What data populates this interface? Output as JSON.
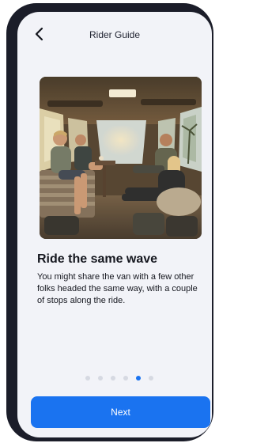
{
  "header": {
    "title": "Rider Guide",
    "back_icon": "chevron-left-icon"
  },
  "content": {
    "image_alt": "Surfers sharing a ride inside a van",
    "headline": "Ride the same wave",
    "description": " You might share the van with a few other folks headed the same way, with a couple of stops along the ride."
  },
  "pagination": {
    "total": 6,
    "current": 5
  },
  "footer": {
    "next_label": "Next"
  },
  "colors": {
    "accent": "#1a73f0",
    "dot_inactive": "#d6d9e2",
    "frame": "#1b1d29",
    "screen_bg": "#f2f3f8"
  }
}
